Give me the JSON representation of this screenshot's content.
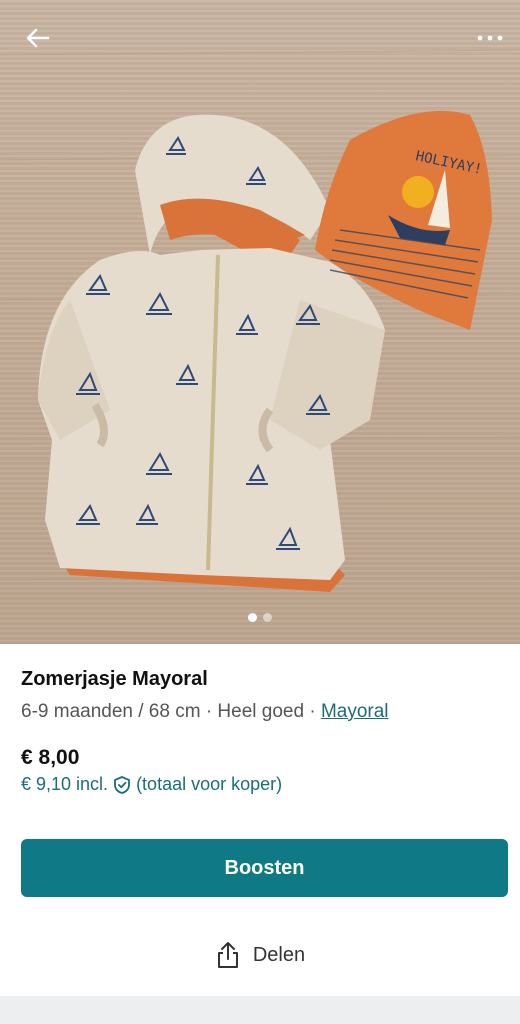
{
  "listing": {
    "title": "Zomerjasje Mayoral",
    "details": "6-9 maanden / 68 cm · Heel goed · ",
    "brand": "Mayoral",
    "price": "€ 8,00",
    "price_incl": "€ 9,10 incl.",
    "price_incl_note": "(totaal voor koper)"
  },
  "gallery": {
    "current": 1,
    "total": 2
  },
  "hat_text": "HOLIYAY!",
  "actions": {
    "boost_label": "Boosten",
    "share_label": "Delen"
  },
  "icons": {
    "back": "arrow-left-icon",
    "more": "more-horizontal-icon",
    "shield": "shield-check-icon",
    "share": "share-icon"
  },
  "colors": {
    "accent": "#0f7a85",
    "link": "#1a6e78",
    "jacket": "#e6dccd",
    "orange": "#e07a3c"
  }
}
